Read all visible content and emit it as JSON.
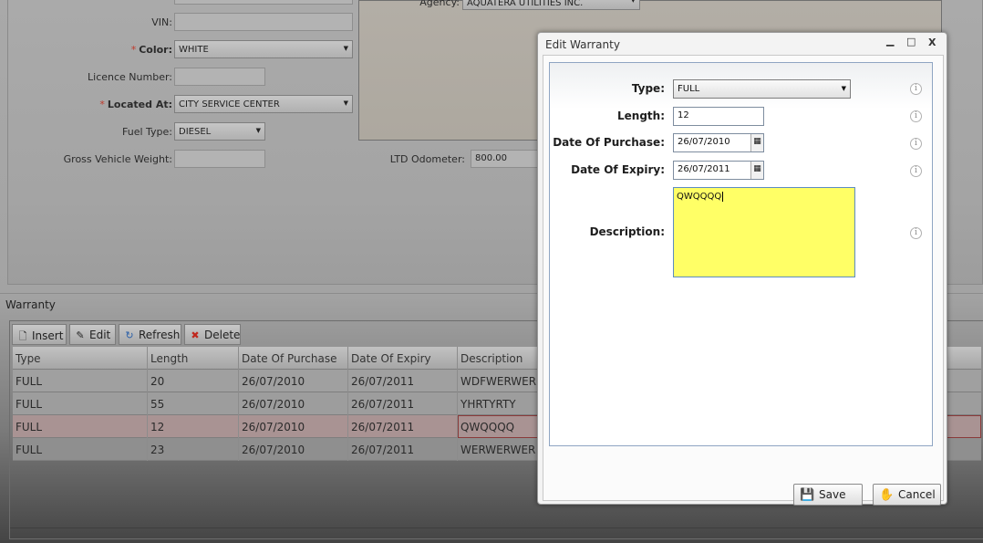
{
  "vehicle_form": {
    "vin_label": "VIN:",
    "vin_value": "",
    "color_label": "Color:",
    "color_value": "WHITE",
    "licence_label": "Licence Number:",
    "licence_value": "",
    "located_label": "Located At:",
    "located_value": "CITY SERVICE CENTER",
    "fuel_label": "Fuel Type:",
    "fuel_value": "DIESEL",
    "gvw_label": "Gross Vehicle Weight:",
    "gvw_value": "",
    "agency_label": "Agency:",
    "agency_value": "AQUATERA UTILITIES INC.",
    "odometer_label": "LTD Odometer:",
    "odometer_value": "800.00",
    "required_marker": "*"
  },
  "warranty": {
    "title": "Warranty",
    "toolbar": {
      "insert": "Insert",
      "edit": "Edit",
      "refresh": "Refresh",
      "delete": "Delete"
    },
    "columns": [
      "Type",
      "Length",
      "Date Of Purchase",
      "Date Of Expiry",
      "Description"
    ],
    "rows": [
      [
        "FULL",
        "20",
        "26/07/2010",
        "26/07/2011",
        "WDFWERWER"
      ],
      [
        "FULL",
        "55",
        "26/07/2010",
        "26/07/2011",
        "YHRTYRTY"
      ],
      [
        "FULL",
        "12",
        "26/07/2010",
        "26/07/2011",
        "QWQQQQ"
      ],
      [
        "FULL",
        "23",
        "26/07/2010",
        "26/07/2011",
        "WERWERWER"
      ]
    ],
    "selected_row": 2
  },
  "dialog": {
    "title": "Edit Warranty",
    "controls": {
      "minimize": "▁",
      "maximize": "□",
      "close": "X"
    },
    "type_label": "Type:",
    "type_value": "FULL",
    "length_label": "Length:",
    "length_value": "12",
    "purchase_label": "Date Of Purchase:",
    "purchase_value": "26/07/2010",
    "expiry_label": "Date Of Expiry:",
    "expiry_value": "26/07/2011",
    "description_label": "Description:",
    "description_value": "QWQQQQ",
    "info_glyph": "i",
    "save_label": "Save",
    "cancel_label": "Cancel"
  },
  "colors": {
    "description_bg": "#ffff66",
    "selected_row": "#a99393",
    "required": "#c0392b"
  }
}
